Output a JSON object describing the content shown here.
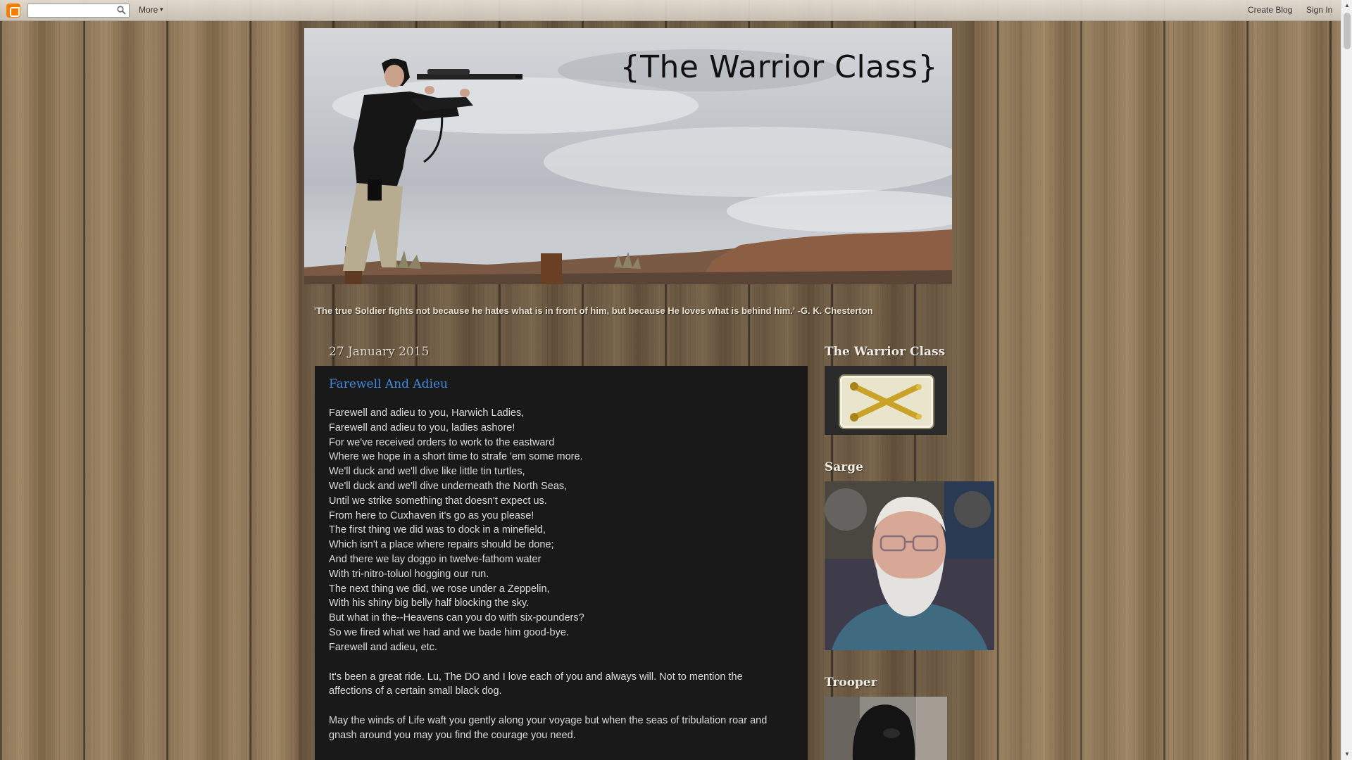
{
  "navbar": {
    "search_placeholder": "",
    "more_label": "More",
    "create_blog_label": "Create Blog",
    "sign_in_label": "Sign In"
  },
  "header": {
    "title": "{The Warrior Class}",
    "tagline": "'The true Soldier fights not because he hates what is in front of him, but because He loves what is behind him.' -G. K. Chesterton"
  },
  "post": {
    "date": "27 January 2015",
    "title": "Farewell And Adieu",
    "poem_lines": [
      "Farewell and adieu to you, Harwich Ladies,",
      "Farewell and adieu to you, ladies ashore!",
      "For we've received orders to work to the eastward",
      "Where we hope in a short time to strafe 'em some more.",
      "We'll duck and we'll dive like little tin turtles,",
      "We'll duck and we'll dive underneath the North Seas,",
      "Until we strike something that doesn't expect us.",
      "From here to Cuxhaven it's go as you please!",
      "The first thing we did was to dock in a minefield,",
      "Which isn't a place where repairs should be done;",
      "And there we lay doggo in twelve-fathom water",
      "With tri-nitro-toluol hogging our run.",
      "The next thing we did, we rose under a Zeppelin,",
      "With his shiny big belly half blocking the sky.",
      "But what in the--Heavens can you do with six-pounders?",
      "So we fired what we had and we bade him good-bye.",
      "Farewell and adieu, etc."
    ],
    "paragraph1": "It's been a great ride. Lu, The DO and I love each of you and always will. Not to mention the affections of a certain small black dog.",
    "paragraph2": "May the winds of Life waft you gently along your voyage but when the seas of tribulation roar and gnash around you may you find the courage you need."
  },
  "sidebar": {
    "widget1_title": "The Warrior Class",
    "widget2_title": "Sarge",
    "widget3_title": "Trooper"
  },
  "colors": {
    "post_background": "#191919",
    "post_title": "#3f8ae0",
    "post_text": "#dcdcdc",
    "blogger_orange": "#f57d00"
  },
  "icons": {
    "blogger_logo": "blogger-logo-icon",
    "search": "search-icon",
    "badge": "crossed-cannons-icon"
  }
}
